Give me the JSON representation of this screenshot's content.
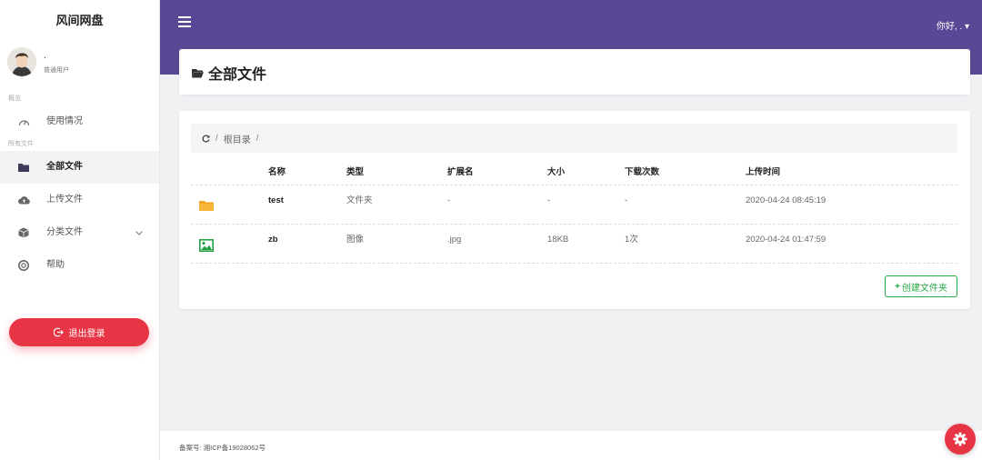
{
  "app": {
    "brand": "风间网盘"
  },
  "user": {
    "name": ".",
    "role": "普通用户"
  },
  "sidebar": {
    "section_overview": "概览",
    "section_files": "所有文件",
    "usage_label": "使用情况",
    "items": [
      {
        "label": "全部文件",
        "icon": "folder-icon",
        "active": true
      },
      {
        "label": "上传文件",
        "icon": "cloud-upload-icon"
      },
      {
        "label": "分类文件",
        "icon": "box-icon"
      },
      {
        "label": "帮助",
        "icon": "lifebuoy-icon"
      }
    ],
    "logout_label": "退出登录"
  },
  "topbar": {
    "greeting": "你好, . ▾"
  },
  "page": {
    "title": "全部文件"
  },
  "breadcrumb": {
    "slash": "/",
    "root": "根目录",
    "trailing": "/"
  },
  "table": {
    "headers": {
      "name": "名称",
      "type": "类型",
      "ext": "扩展名",
      "size": "大小",
      "downloads": "下载次数",
      "time": "上传时间"
    },
    "rows": [
      {
        "name": "test",
        "type": "文件夹",
        "ext": "-",
        "size": "-",
        "downloads": "-",
        "time": "2020-04-24 08:45:19",
        "icon": "folder-icon"
      },
      {
        "name": "zb",
        "type": "图像",
        "ext": ".jpg",
        "size": "18KB",
        "downloads": "1次",
        "time": "2020-04-24 01:47:59",
        "icon": "image-icon"
      }
    ]
  },
  "actions": {
    "create_folder": "创建文件夹"
  },
  "footer": {
    "icp": "备案号: 湘ICP备19028062号"
  },
  "colors": {
    "topbar": "#5a4896",
    "accent_red": "#e83546",
    "success_green": "#28a745",
    "folder_yellow": "#f5a623"
  }
}
